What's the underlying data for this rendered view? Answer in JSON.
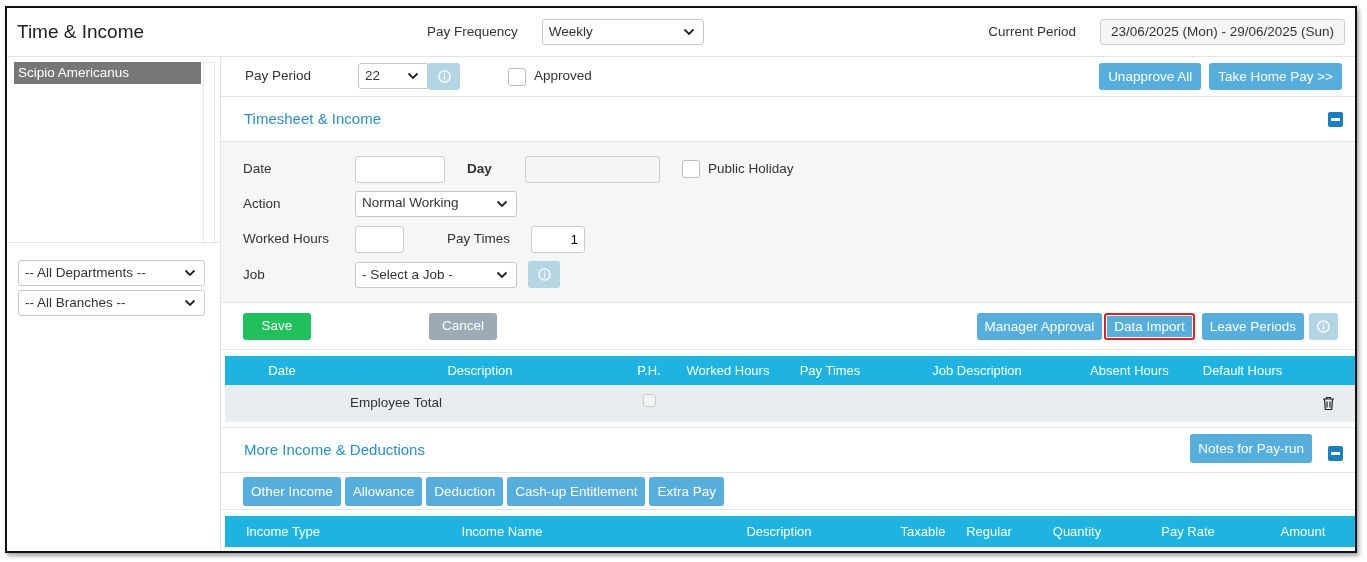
{
  "window": {
    "title": "Time & Income"
  },
  "header": {
    "pay_frequency_label": "Pay Frequency",
    "pay_frequency": "Weekly",
    "current_period_label": "Current Period",
    "current_period": "23/06/2025 (Mon) - 29/06/2025 (Sun)"
  },
  "sidebar": {
    "employees": [
      {
        "name": "Scipio Americanus",
        "selected": true
      }
    ],
    "filters": [
      {
        "value": "-- All Departments --"
      },
      {
        "value": "-- All Branches --"
      }
    ]
  },
  "pay_period": {
    "label": "Pay Period",
    "value": "22",
    "approved_label": "Approved",
    "approved": false
  },
  "top_buttons": [
    {
      "label": "Unapprove All"
    },
    {
      "label": "Take Home Pay >>"
    }
  ],
  "timesheet": {
    "title": "Timesheet & Income",
    "expanded": true,
    "form": {
      "date_label": "Date",
      "day_label": "Day",
      "public_holiday_label": "Public Holiday",
      "public_holiday": false,
      "action_label": "Action",
      "action": "Normal Working",
      "worked_hours_label": "Worked Hours",
      "pay_times_label": "Pay Times",
      "pay_times": "1",
      "job_label": "Job",
      "job": "- Select a Job -"
    },
    "save": "Save",
    "cancel": "Cancel",
    "buttons": [
      {
        "label": "Manager Approval",
        "highlighted": false
      },
      {
        "label": "Data Import",
        "highlighted": true
      },
      {
        "label": "Leave Periods",
        "highlighted": false
      }
    ],
    "columns": [
      "Date",
      "Description",
      "P.H.",
      "Worked Hours",
      "Pay Times",
      "Job Description",
      "Absent Hours",
      "Default Hours"
    ],
    "rows": [
      {
        "description": "Employee Total",
        "public_holiday": false
      }
    ]
  },
  "more_income": {
    "title": "More Income & Deductions",
    "expanded": true,
    "notes_button": "Notes for Pay-run",
    "buttons": [
      "Other Income",
      "Allowance",
      "Deduction",
      "Cash-up Entitlement",
      "Extra Pay"
    ],
    "columns": [
      "Income Type",
      "Income Name",
      "Description",
      "Taxable",
      "Regular",
      "Quantity",
      "Pay Rate",
      "Amount"
    ]
  }
}
